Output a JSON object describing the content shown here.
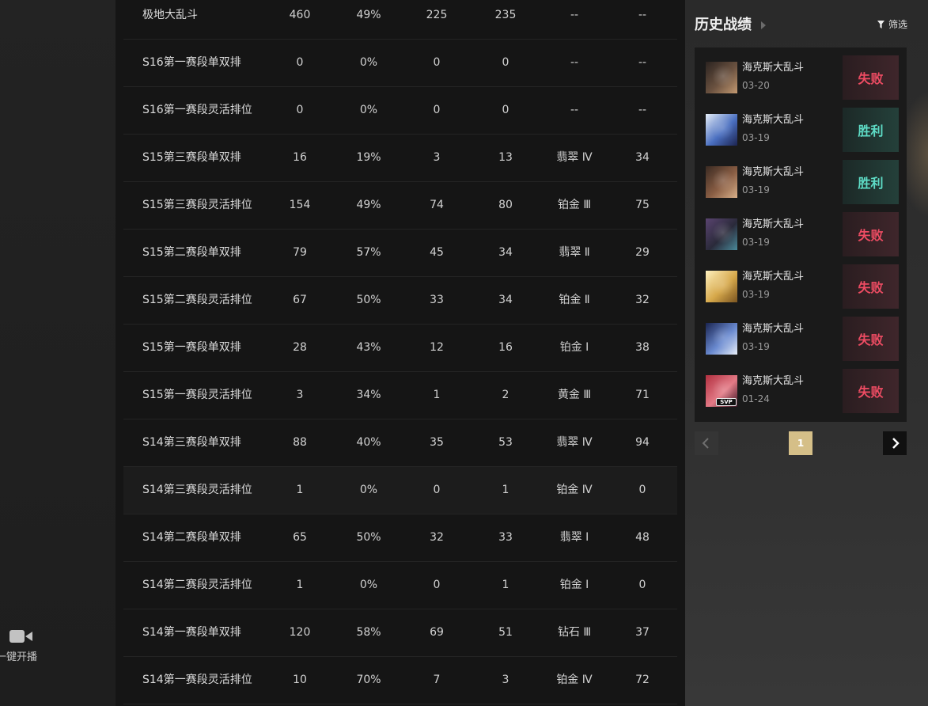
{
  "sidebar": {
    "go_live_label": "一键开播",
    "camera_icon": "camera-icon"
  },
  "stats_table": {
    "rows": [
      {
        "name": "极地大乱斗",
        "games": 460,
        "win_rate": "49%",
        "wins": 225,
        "losses": 235,
        "rank": "--",
        "points": "--"
      },
      {
        "name": "S16第一赛段单双排",
        "games": 0,
        "win_rate": "0%",
        "wins": 0,
        "losses": 0,
        "rank": "--",
        "points": "--"
      },
      {
        "name": "S16第一赛段灵活排位",
        "games": 0,
        "win_rate": "0%",
        "wins": 0,
        "losses": 0,
        "rank": "--",
        "points": "--"
      },
      {
        "name": "S15第三赛段单双排",
        "games": 16,
        "win_rate": "19%",
        "wins": 3,
        "losses": 13,
        "rank": "翡翠 Ⅳ",
        "points": 34
      },
      {
        "name": "S15第三赛段灵活排位",
        "games": 154,
        "win_rate": "49%",
        "wins": 74,
        "losses": 80,
        "rank": "铂金 Ⅲ",
        "points": 75
      },
      {
        "name": "S15第二赛段单双排",
        "games": 79,
        "win_rate": "57%",
        "wins": 45,
        "losses": 34,
        "rank": "翡翠 Ⅱ",
        "points": 29
      },
      {
        "name": "S15第二赛段灵活排位",
        "games": 67,
        "win_rate": "50%",
        "wins": 33,
        "losses": 34,
        "rank": "铂金 Ⅱ",
        "points": 32
      },
      {
        "name": "S15第一赛段单双排",
        "games": 28,
        "win_rate": "43%",
        "wins": 12,
        "losses": 16,
        "rank": "铂金 Ⅰ",
        "points": 38
      },
      {
        "name": "S15第一赛段灵活排位",
        "games": 3,
        "win_rate": "34%",
        "wins": 1,
        "losses": 2,
        "rank": "黄金 Ⅲ",
        "points": 71
      },
      {
        "name": "S14第三赛段单双排",
        "games": 88,
        "win_rate": "40%",
        "wins": 35,
        "losses": 53,
        "rank": "翡翠 Ⅳ",
        "points": 94
      },
      {
        "name": "S14第三赛段灵活排位",
        "games": 1,
        "win_rate": "0%",
        "wins": 0,
        "losses": 1,
        "rank": "铂金 Ⅳ",
        "points": 0
      },
      {
        "name": "S14第二赛段单双排",
        "games": 65,
        "win_rate": "50%",
        "wins": 32,
        "losses": 33,
        "rank": "翡翠 Ⅰ",
        "points": 48
      },
      {
        "name": "S14第二赛段灵活排位",
        "games": 1,
        "win_rate": "0%",
        "wins": 0,
        "losses": 1,
        "rank": "铂金 Ⅰ",
        "points": 0
      },
      {
        "name": "S14第一赛段单双排",
        "games": 120,
        "win_rate": "58%",
        "wins": 69,
        "losses": 51,
        "rank": "钻石 Ⅲ",
        "points": 37
      },
      {
        "name": "S14第一赛段灵活排位",
        "games": 10,
        "win_rate": "70%",
        "wins": 7,
        "losses": 3,
        "rank": "铂金 Ⅳ",
        "points": 72
      }
    ]
  },
  "history": {
    "title": "历史战绩",
    "title_arrow_icon": "caret-right-icon",
    "filter_icon": "filter-icon",
    "filter_label": "筛选",
    "matches": [
      {
        "mode": "海克斯大乱斗",
        "date": "03-20",
        "result": "失败",
        "result_color": "#ee4c63",
        "result_bg": [
          "#2a1d20",
          "#3f262b"
        ],
        "avatar_colors": [
          "#2b2320",
          "#6b5240",
          "#c49a72"
        ]
      },
      {
        "mode": "海克斯大乱斗",
        "date": "03-19",
        "result": "胜利",
        "result_color": "#5edcc6",
        "result_bg": [
          "#1c2927",
          "#24403a"
        ],
        "avatar_colors": [
          "#e6eef8",
          "#4a6fc0",
          "#1c2450"
        ]
      },
      {
        "mode": "海克斯大乱斗",
        "date": "03-19",
        "result": "胜利",
        "result_color": "#5edcc6",
        "result_bg": [
          "#1c2927",
          "#24403a"
        ],
        "avatar_colors": [
          "#3a2a22",
          "#8a5e44",
          "#d8b08a"
        ]
      },
      {
        "mode": "海克斯大乱斗",
        "date": "03-19",
        "result": "失败",
        "result_color": "#ee4c63",
        "result_bg": [
          "#2a1d20",
          "#3f262b"
        ],
        "avatar_colors": [
          "#5a4470",
          "#2a2a3a",
          "#4a8a9a"
        ]
      },
      {
        "mode": "海克斯大乱斗",
        "date": "03-19",
        "result": "失败",
        "result_color": "#ee4c63",
        "result_bg": [
          "#2a1d20",
          "#3f262b"
        ],
        "avatar_colors": [
          "#fff1c0",
          "#d6a84a",
          "#7a5420"
        ]
      },
      {
        "mode": "海克斯大乱斗",
        "date": "03-19",
        "result": "失败",
        "result_color": "#ee4c63",
        "result_bg": [
          "#2a1d20",
          "#3f262b"
        ],
        "avatar_colors": [
          "#1a2450",
          "#6a8ad0",
          "#e8eef8"
        ]
      },
      {
        "mode": "海克斯大乱斗",
        "date": "01-24",
        "result": "失败",
        "result_color": "#ee4c63",
        "result_bg": [
          "#2a1d20",
          "#3f262b"
        ],
        "avatar_colors": [
          "#b23040",
          "#e37a86",
          "#3a1524"
        ],
        "badge": "SVP"
      }
    ]
  },
  "pagination": {
    "current_page": "1",
    "prev_icon": "chevron-left-icon",
    "next_icon": "chevron-right-icon"
  },
  "colors": {
    "page_active_bg": "#d5bf88",
    "loss": "#ee4c63",
    "win": "#5edcc6"
  }
}
